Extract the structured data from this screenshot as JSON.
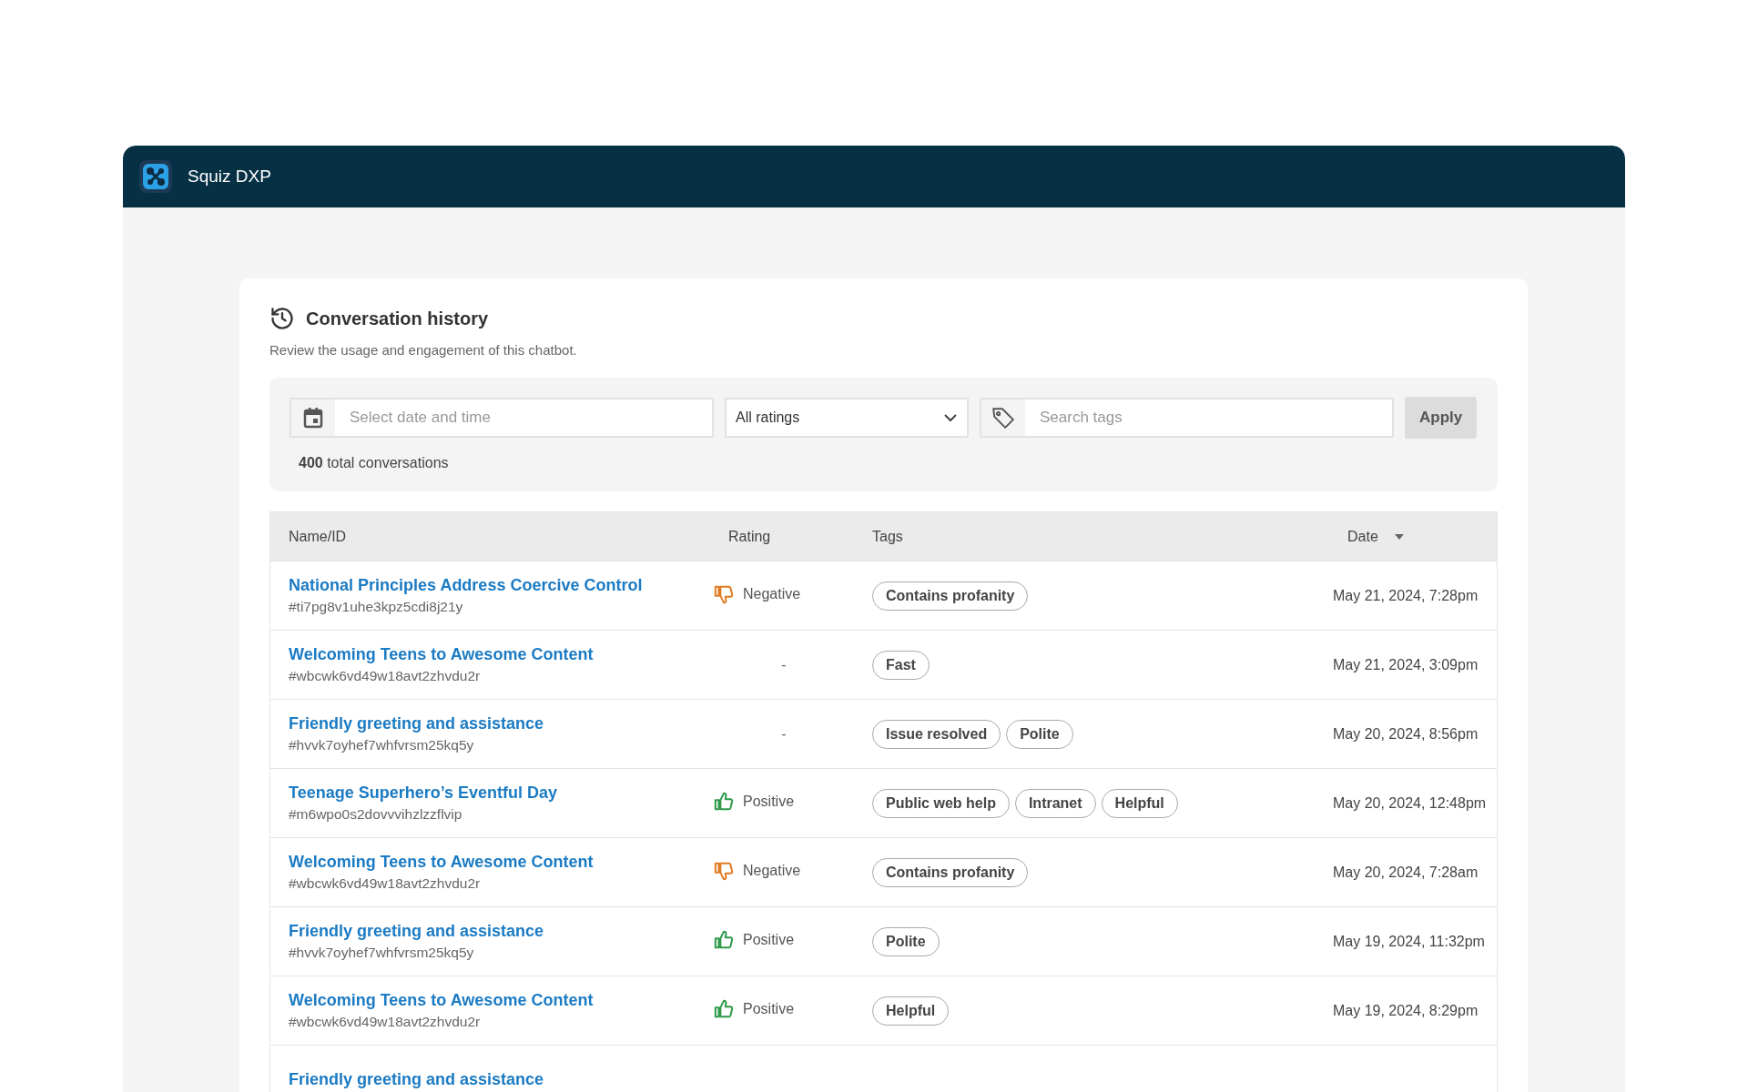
{
  "app": {
    "title": "Squiz DXP"
  },
  "panel": {
    "title": "Conversation history",
    "subtitle": "Review the usage and engagement of this chatbot."
  },
  "filters": {
    "date": {
      "placeholder": "Select date and time"
    },
    "ratings": {
      "value": "All ratings"
    },
    "tags": {
      "placeholder": "Search tags"
    },
    "apply": "Apply",
    "total": "**400** total conversations"
  },
  "table": {
    "columns": [
      {
        "label": "Name/ID",
        "sorted": false
      },
      {
        "label": "Rating",
        "sorted": false
      },
      {
        "label": "Tags",
        "sorted": false
      },
      {
        "label": "Date",
        "sorted": true
      }
    ],
    "rows": [
      {
        "name": "National Principles Address Coercive Control",
        "id": "#ti7pg8v1uhe3kpz5cdi8j21y",
        "rating": {
          "kind": "negative",
          "label": "Negative"
        },
        "tags": [
          "Contains profanity"
        ],
        "date": "May 21, 2024, 7:28pm"
      },
      {
        "name": "Welcoming Teens to Awesome Content",
        "id": "#wbcwk6vd49w18avt2zhvdu2r",
        "rating": {
          "kind": "none",
          "label": "-"
        },
        "tags": [
          "Fast"
        ],
        "date": "May 21, 2024, 3:09pm"
      },
      {
        "name": "Friendly greeting and assistance",
        "id": "#hvvk7oyhef7whfvrsm25kq5y",
        "rating": {
          "kind": "none",
          "label": "-"
        },
        "tags": [
          "Issue resolved",
          "Polite"
        ],
        "date": "May 20, 2024, 8:56pm"
      },
      {
        "name": "Teenage Superhero’s Eventful Day",
        "id": "#m6wpo0s2dovvvihzlzzflvip",
        "rating": {
          "kind": "positive",
          "label": "Positive"
        },
        "tags": [
          "Public web help",
          "Intranet",
          "Helpful"
        ],
        "date": "May 20, 2024, 12:48pm"
      },
      {
        "name": "Welcoming Teens to Awesome Content",
        "id": "#wbcwk6vd49w18avt2zhvdu2r",
        "rating": {
          "kind": "negative",
          "label": "Negative"
        },
        "tags": [
          "Contains profanity"
        ],
        "date": "May 20, 2024, 7:28am"
      },
      {
        "name": "Friendly greeting and assistance",
        "id": "#hvvk7oyhef7whfvrsm25kq5y",
        "rating": {
          "kind": "positive",
          "label": "Positive"
        },
        "tags": [
          "Polite"
        ],
        "date": "May 19, 2024, 11:32pm"
      },
      {
        "name": "Welcoming Teens to Awesome Content",
        "id": "#wbcwk6vd49w18avt2zhvdu2r",
        "rating": {
          "kind": "positive",
          "label": "Positive"
        },
        "tags": [
          "Helpful"
        ],
        "date": "May 19, 2024, 8:29pm"
      },
      {
        "name": "Friendly greeting and assistance"
      }
    ]
  }
}
